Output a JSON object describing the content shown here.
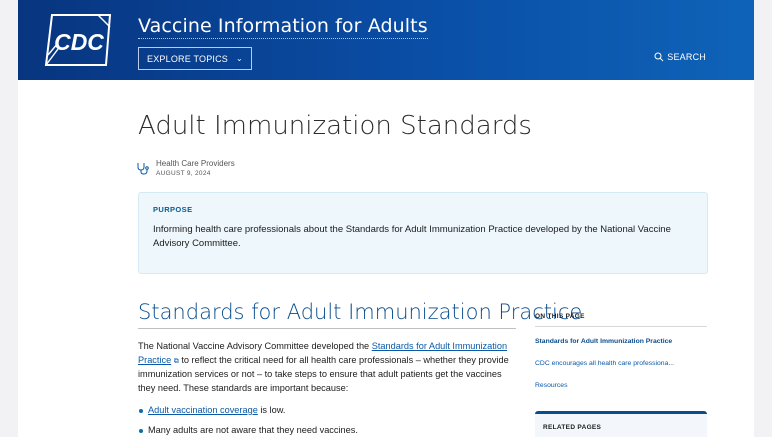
{
  "header": {
    "logo_text": "CDC",
    "site_title": "Vaccine Information for Adults",
    "explore_label": "EXPLORE TOPICS",
    "search_label": "SEARCH"
  },
  "page": {
    "title": "Adult Immunization Standards",
    "audience": "Health Care Providers",
    "date": "AUGUST 9, 2024"
  },
  "purpose": {
    "label": "PURPOSE",
    "text": "Informing health care professionals about the Standards for Adult Immunization Practice developed by the National Vaccine Advisory Committee."
  },
  "section": {
    "heading": "Standards for Adult Immunization Practice",
    "intro_before_link": "The National Vaccine Advisory Committee developed the ",
    "intro_link": "Standards for Adult Immunization Practice",
    "intro_after_link": " to reflect the critical need for all health care professionals – whether they provide immunization services or not – to take steps to ensure that adult patients get the vaccines they need. These standards are important because:",
    "bullet1_link": "Adult vaccination coverage",
    "bullet1_rest": " is low.",
    "bullet2": "Many adults are not aware that they need vaccines."
  },
  "toc": {
    "heading": "ON THIS PAGE",
    "items": [
      "Standards for Adult Immunization Practice",
      "CDC encourages all health care professiona...",
      "Resources"
    ]
  },
  "related": {
    "heading": "RELATED PAGES"
  },
  "colors": {
    "header_start": "#08357f",
    "header_end": "#0e63b8",
    "link": "#0a59a8",
    "purpose_bg": "#eef7fb"
  },
  "icons": [
    "cdc-logo",
    "chevron-down-icon",
    "search-icon",
    "stethoscope-icon",
    "external-link-icon"
  ]
}
